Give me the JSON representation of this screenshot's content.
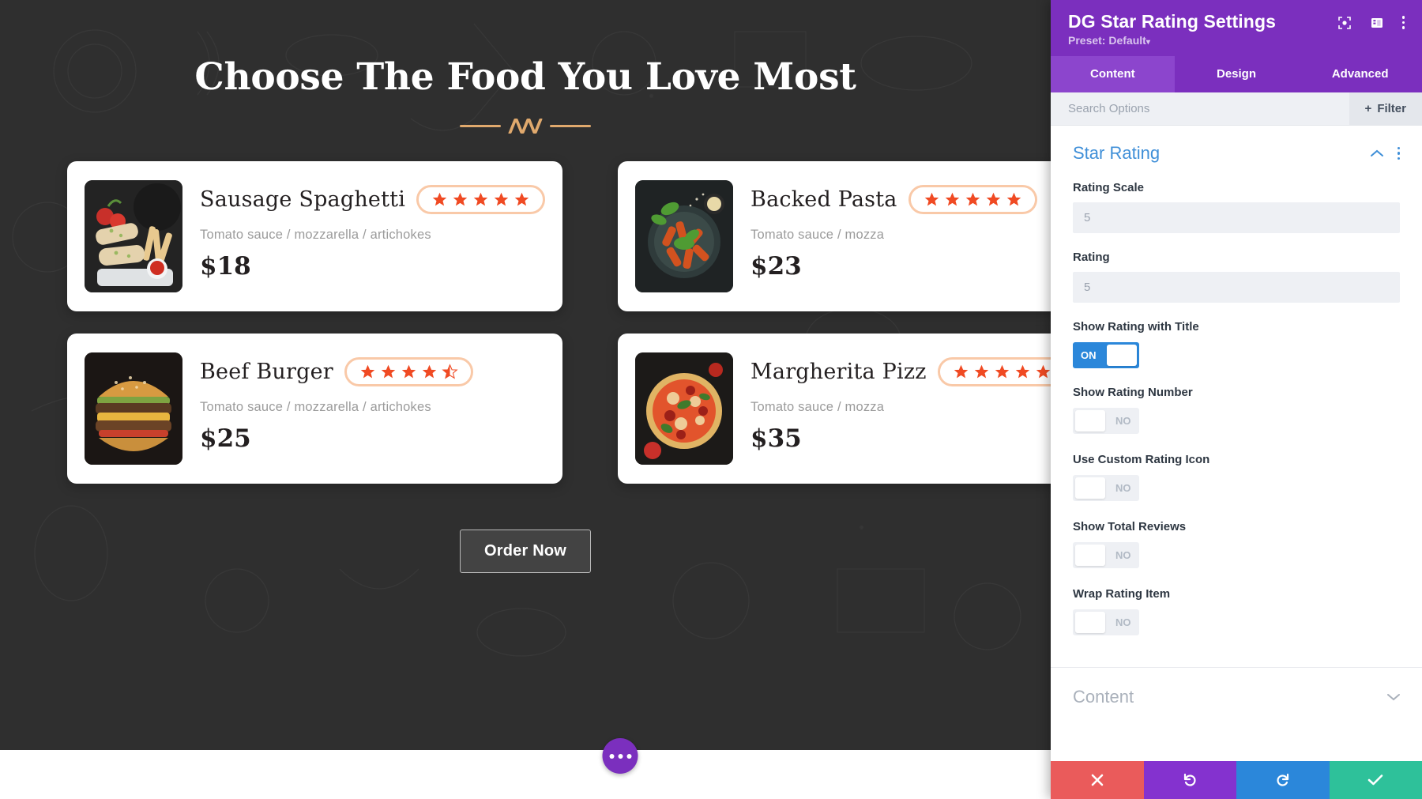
{
  "page": {
    "title": "Choose The Food You Love Most",
    "order_button": "Order Now",
    "fab": "more-options",
    "cards": [
      {
        "name": "Sausage Spaghetti",
        "desc": "Tomato sauce / mozzarella / artichokes",
        "price": "$18",
        "rating": 5,
        "image": "sausage-wrap-with-fries"
      },
      {
        "name": "Backed Pasta",
        "desc": "Tomato sauce / mozza",
        "price": "$23",
        "rating": 5,
        "image": "penne-pasta-bowl"
      },
      {
        "name": "Beef Burger",
        "desc": "Tomato sauce / mozzarella / artichokes",
        "price": "$25",
        "rating": 4.5,
        "image": "beef-burger"
      },
      {
        "name": "Margherita Pizz",
        "desc": "Tomato sauce / mozza",
        "price": "$35",
        "rating": 5,
        "image": "margherita-pizza"
      }
    ]
  },
  "panel": {
    "title": "DG Star Rating Settings",
    "preset": "Preset: Default",
    "preset_caret": "▾",
    "icons": {
      "focus": "focus-icon",
      "layout": "layout-icon",
      "menu": "kebab-menu-icon"
    },
    "tabs": [
      {
        "label": "Content",
        "active": true
      },
      {
        "label": "Design",
        "active": false
      },
      {
        "label": "Advanced",
        "active": false
      }
    ],
    "search_placeholder": "Search Options",
    "filter_label": "Filter",
    "filter_plus": "+",
    "group": {
      "title": "Star Rating",
      "collapse_caret": "⌃"
    },
    "fields": [
      {
        "label": "Rating Scale",
        "type": "text",
        "value": "5"
      },
      {
        "label": "Rating",
        "type": "text",
        "value": "5"
      },
      {
        "label": "Show Rating with Title",
        "type": "toggle",
        "state": "on",
        "state_label": "ON"
      },
      {
        "label": "Show Rating Number",
        "type": "toggle",
        "state": "off",
        "state_label": "NO"
      },
      {
        "label": "Use Custom Rating Icon",
        "type": "toggle",
        "state": "off",
        "state_label": "NO"
      },
      {
        "label": "Show Total Reviews",
        "type": "toggle",
        "state": "off",
        "state_label": "NO"
      },
      {
        "label": "Wrap Rating Item",
        "type": "toggle",
        "state": "off",
        "state_label": "NO"
      }
    ],
    "collapsed_group": {
      "title": "Content",
      "caret": "⌄"
    },
    "actions": [
      {
        "name": "discard",
        "icon": "close-icon",
        "color": "#ea5b5b"
      },
      {
        "name": "undo",
        "icon": "undo-icon",
        "color": "#8432cf"
      },
      {
        "name": "redo",
        "icon": "redo-icon",
        "color": "#2b87da"
      },
      {
        "name": "save",
        "icon": "check-icon",
        "color": "#2ec19a"
      }
    ]
  },
  "colors": {
    "brand_purple": "#7b2fbe",
    "accent_blue": "#3f8fd8",
    "star_orange": "#f04a23",
    "star_pill_border": "#f9c9a8",
    "divider_tan": "#e0a96d"
  }
}
